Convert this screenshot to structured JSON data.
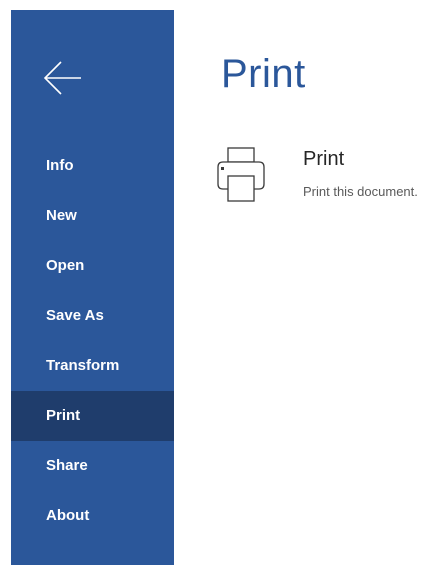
{
  "sidebar": {
    "back_icon": "arrow-left-icon",
    "items": [
      {
        "label": "Info"
      },
      {
        "label": "New"
      },
      {
        "label": "Open"
      },
      {
        "label": "Save As"
      },
      {
        "label": "Transform"
      },
      {
        "label": "Print",
        "active": true
      },
      {
        "label": "Share"
      },
      {
        "label": "About"
      }
    ]
  },
  "main": {
    "title": "Print",
    "print_option": {
      "icon": "printer-icon",
      "title": "Print",
      "description": "Print this document."
    }
  },
  "colors": {
    "sidebar_bg": "#2b579a",
    "sidebar_active_bg": "#1f3d6c",
    "title_color": "#2b579a"
  }
}
